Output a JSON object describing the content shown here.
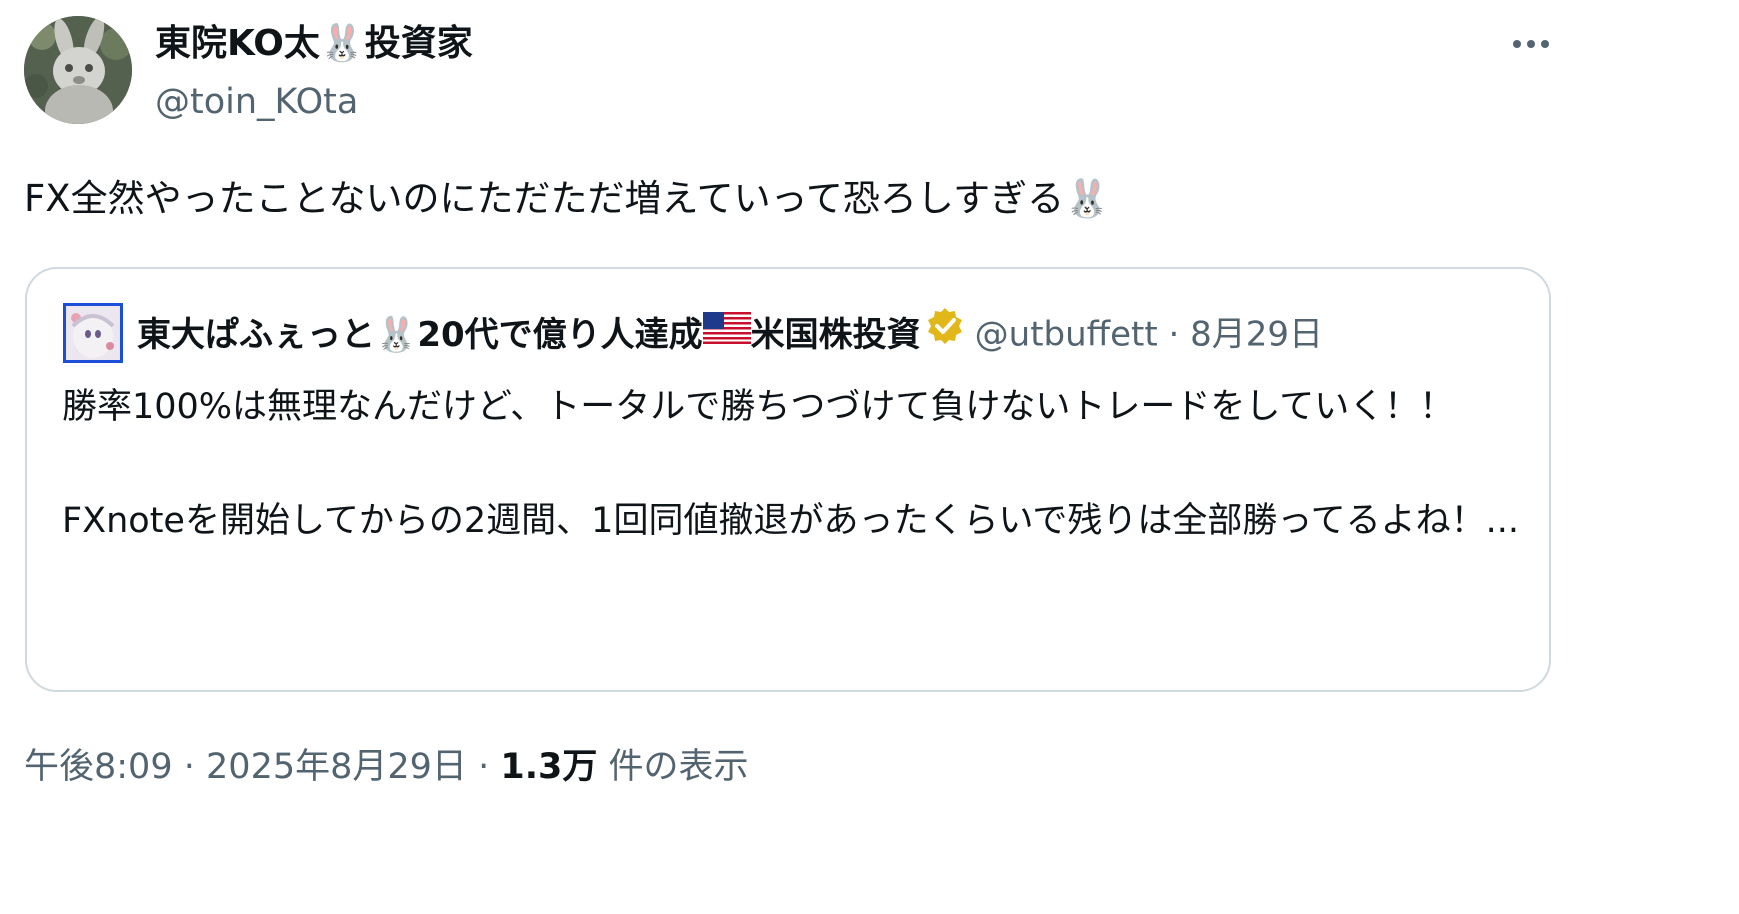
{
  "author": {
    "name_prefix": "東院KO太",
    "name_emoji": "🐰",
    "name_suffix": "投資家",
    "handle": "@toin_KOta"
  },
  "more_icon": "more-horizontal-icon",
  "tweet": {
    "text": "FX全然やったことないのにただただ増えていって恐ろしすぎる",
    "emoji": "🐰"
  },
  "quote": {
    "name_a": "東大ぱふぇっと",
    "emoji_rabbit": "🐰",
    "name_b": "20代で億り人達成",
    "flag": "🇺🇸",
    "name_c": "米国株投資",
    "verified_icon": "verified-badge-icon",
    "handle": "@utbuffett",
    "separator": "·",
    "date": "8月29日",
    "body": "勝率100%は無理なんだけど、トータルで勝ちつづけて負けないトレードをしていく！！\n\nFXnoteを開始してからの2週間、1回同値撤退があったくらいで残りは全部勝ってるよね！..."
  },
  "meta": {
    "time": "午後8:09",
    "sep1": "·",
    "date": "2025年8月29日",
    "sep2": "·",
    "views_count": "1.3万",
    "views_label": "件の表示"
  },
  "colors": {
    "text_primary": "#0f1419",
    "text_secondary": "#536471",
    "border": "#cfd9de",
    "verified_gold": "#e2b719"
  }
}
